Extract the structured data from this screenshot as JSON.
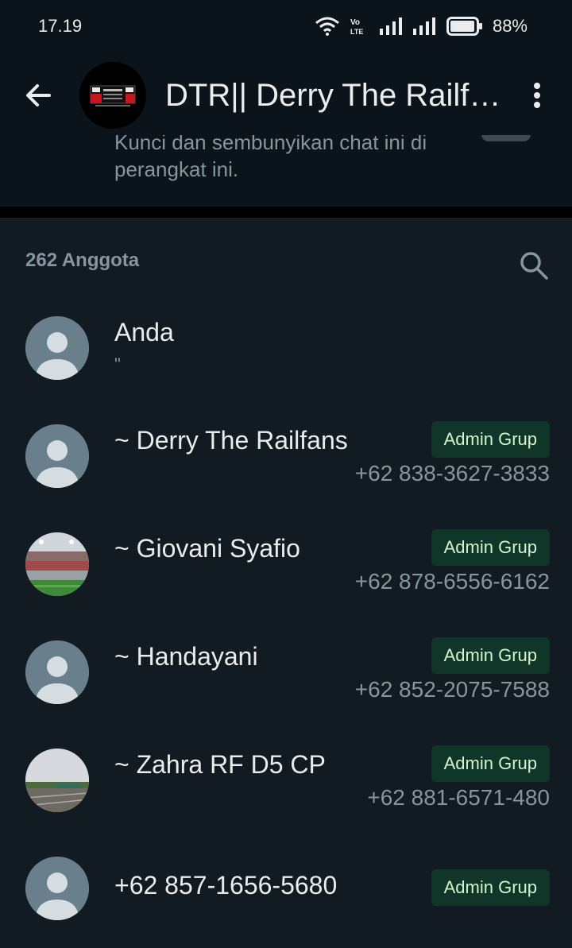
{
  "status_bar": {
    "time": "17.19",
    "battery": "88%",
    "icons": [
      "wifi-icon",
      "volte-icon",
      "signal-icon",
      "signal-icon",
      "battery-icon"
    ]
  },
  "header": {
    "title": "DTR|| Derry The Railf…",
    "back_icon": "arrow-left-icon",
    "menu_icon": "more-vertical-icon"
  },
  "lock_chat": {
    "description": "Kunci dan sembunyikan chat ini di perangkat ini."
  },
  "members": {
    "count_label": "262 Anggota",
    "items": [
      {
        "name": "Anda",
        "sub": "\"",
        "badge": "",
        "phone": ""
      },
      {
        "name": "~ Derry The Railfans",
        "sub": "",
        "badge": "Admin Grup",
        "phone": "+62 838-3627-3833"
      },
      {
        "name": "~ Giovani Syafio",
        "sub": "",
        "badge": "Admin Grup",
        "phone": "+62 878-6556-6162"
      },
      {
        "name": "~ Handayani",
        "sub": "",
        "badge": "Admin Grup",
        "phone": "+62 852-2075-7588"
      },
      {
        "name": "~ Zahra RF D5 CP",
        "sub": "",
        "badge": "Admin Grup",
        "phone": "+62 881-6571-480"
      },
      {
        "name": "+62 857-1656-5680",
        "sub": "",
        "badge": "Admin Grup",
        "phone": ""
      }
    ]
  },
  "colors": {
    "background": "#0b141a",
    "section": "#111b21",
    "badge_bg": "#103529",
    "badge_text": "#d1f4cc",
    "secondary_text": "#8696a0"
  }
}
